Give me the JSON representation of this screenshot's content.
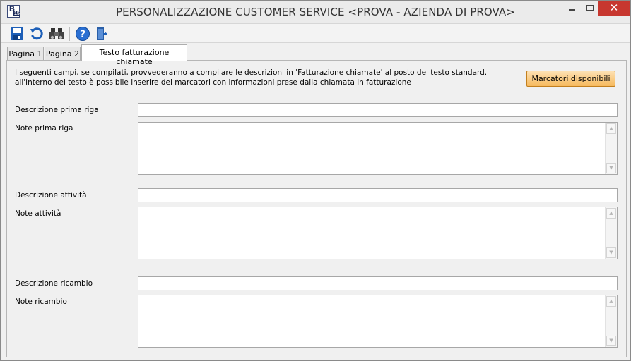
{
  "window": {
    "title": "PERSONALIZZAZIONE CUSTOMER SERVICE <PROVA - AZIENDA DI PROVA>",
    "icon_letter": "B",
    "icon_number": "15",
    "close_glyph": "✕"
  },
  "toolbar": {
    "buttons": [
      "save-icon",
      "undo-icon",
      "binoculars-icon",
      "help-icon",
      "exit-door-icon"
    ]
  },
  "tabs": [
    {
      "label": "Pagina 1",
      "active": false
    },
    {
      "label": "Pagina 2",
      "active": false
    },
    {
      "label": "Testo fatturazione chiamate",
      "active": true
    }
  ],
  "intro": {
    "line1": "I seguenti campi, se compilati, provvederanno a compilare le descrizioni in 'Fatturazione chiamate' al posto del testo standard.",
    "line2": "all'interno del testo è possibile inserire dei marcatori con informazioni prese dalla chiamata in fatturazione"
  },
  "markers_button": "Marcatori disponibili",
  "fields": {
    "desc_first_row": {
      "label": "Descrizione prima riga",
      "value": ""
    },
    "note_first_row": {
      "label": "Note prima riga",
      "value": ""
    },
    "desc_activity": {
      "label": "Descrizione attività",
      "value": ""
    },
    "note_activity": {
      "label": "Note attività",
      "value": ""
    },
    "desc_spare": {
      "label": "Descrizione ricambio",
      "value": ""
    },
    "note_spare": {
      "label": "Note ricambio",
      "value": ""
    }
  },
  "colors": {
    "close_button": "#c7372f",
    "markers_button": "#f6b95e",
    "toolbar_icon_blue": "#1d5fb8"
  }
}
